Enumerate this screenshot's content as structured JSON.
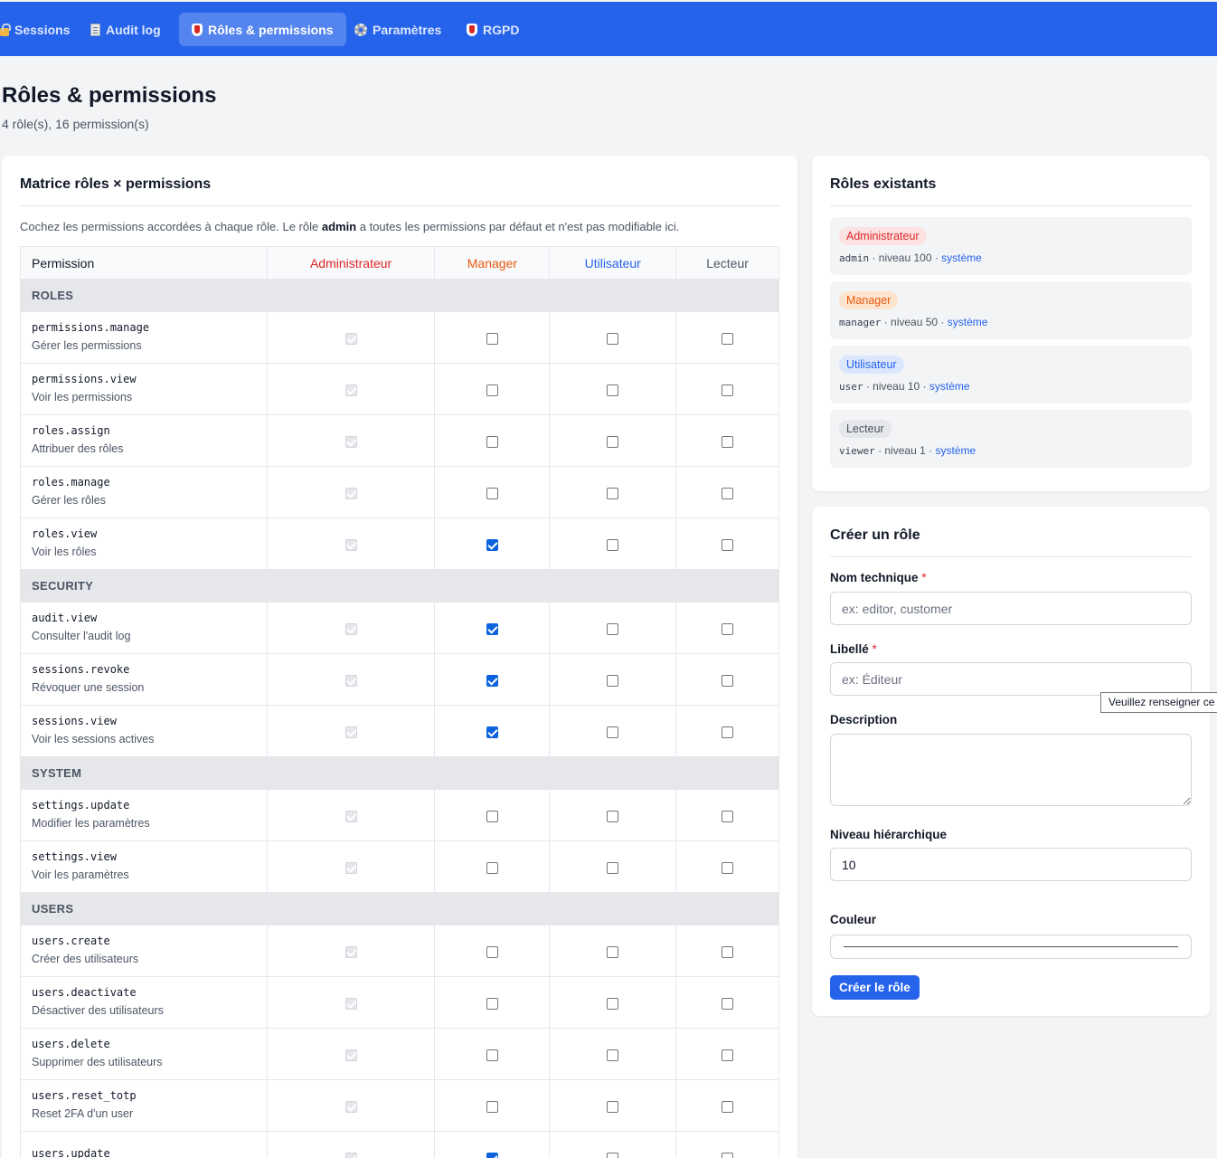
{
  "nav": {
    "items": [
      {
        "label": "Sessions",
        "icon": "lock-icon"
      },
      {
        "label": "Audit log",
        "icon": "document-icon"
      },
      {
        "label": "Rôles & permissions",
        "icon": "shield-icon",
        "active": true
      },
      {
        "label": "Paramètres",
        "icon": "gear-icon"
      },
      {
        "label": "RGPD",
        "icon": "shield-icon"
      }
    ]
  },
  "header": {
    "title": "Rôles & permissions",
    "subtitle": "4 rôle(s), 16 permission(s)"
  },
  "matrix": {
    "title": "Matrice rôles × permissions",
    "intro_before": "Cochez les permissions accordées à chaque rôle. Le rôle ",
    "intro_bold": "admin",
    "intro_after": " a toutes les permissions par défaut et n'est pas modifiable ici.",
    "columns": {
      "permission": "Permission",
      "admin": "Administrateur",
      "manager": "Manager",
      "user": "Utilisateur",
      "viewer": "Lecteur"
    },
    "groups": [
      {
        "name": "ROLES",
        "permissions": [
          {
            "code": "permissions.manage",
            "label": "Gérer les permissions",
            "manager": false,
            "user": false,
            "viewer": false
          },
          {
            "code": "permissions.view",
            "label": "Voir les permissions",
            "manager": false,
            "user": false,
            "viewer": false
          },
          {
            "code": "roles.assign",
            "label": "Attribuer des rôles",
            "manager": false,
            "user": false,
            "viewer": false
          },
          {
            "code": "roles.manage",
            "label": "Gérer les rôles",
            "manager": false,
            "user": false,
            "viewer": false
          },
          {
            "code": "roles.view",
            "label": "Voir les rôles",
            "manager": true,
            "user": false,
            "viewer": false
          }
        ]
      },
      {
        "name": "SECURITY",
        "permissions": [
          {
            "code": "audit.view",
            "label": "Consulter l'audit log",
            "manager": true,
            "user": false,
            "viewer": false
          },
          {
            "code": "sessions.revoke",
            "label": "Révoquer une session",
            "manager": true,
            "user": false,
            "viewer": false
          },
          {
            "code": "sessions.view",
            "label": "Voir les sessions actives",
            "manager": true,
            "user": false,
            "viewer": false
          }
        ]
      },
      {
        "name": "SYSTEM",
        "permissions": [
          {
            "code": "settings.update",
            "label": "Modifier les paramètres",
            "manager": false,
            "user": false,
            "viewer": false
          },
          {
            "code": "settings.view",
            "label": "Voir les paramètres",
            "manager": false,
            "user": false,
            "viewer": false
          }
        ]
      },
      {
        "name": "USERS",
        "permissions": [
          {
            "code": "users.create",
            "label": "Créer des utilisateurs",
            "manager": false,
            "user": false,
            "viewer": false
          },
          {
            "code": "users.deactivate",
            "label": "Désactiver des utilisateurs",
            "manager": false,
            "user": false,
            "viewer": false
          },
          {
            "code": "users.delete",
            "label": "Supprimer des utilisateurs",
            "manager": false,
            "user": false,
            "viewer": false
          },
          {
            "code": "users.reset_totp",
            "label": "Reset 2FA d'un user",
            "manager": false,
            "user": false,
            "viewer": false
          },
          {
            "code": "users.update",
            "label": "",
            "manager": true,
            "user": false,
            "viewer": false
          }
        ]
      }
    ]
  },
  "roles_card": {
    "title": "Rôles existants",
    "roles": [
      {
        "badge": "Administrateur",
        "code": "admin",
        "level": " · niveau 100 · ",
        "system": "système",
        "color": "#dc2626",
        "bg": "#fde2e2"
      },
      {
        "badge": "Manager",
        "code": "manager",
        "level": " · niveau 50 · ",
        "system": "système",
        "color": "#ea580c",
        "bg": "#fde4cf"
      },
      {
        "badge": "Utilisateur",
        "code": "user",
        "level": " · niveau 10 · ",
        "system": "système",
        "color": "#2563eb",
        "bg": "#dbe7fd"
      },
      {
        "badge": "Lecteur",
        "code": "viewer",
        "level": " · niveau 1 · ",
        "system": "système",
        "color": "#4b5563",
        "bg": "#e5e7eb"
      }
    ]
  },
  "create_form": {
    "title": "Créer un rôle",
    "name_label": "Nom technique",
    "name_placeholder": "ex: editor, customer",
    "libelle_label": "Libellé",
    "libelle_placeholder": "ex: Éditeur",
    "required_mark": "*",
    "description_label": "Description",
    "level_label": "Niveau hiérarchique",
    "level_value": "10",
    "color_label": "Couleur",
    "submit_label": "Créer le rôle",
    "tooltip": "Veuillez renseigner ce champ."
  },
  "colors": {
    "accent": "#2563eb",
    "nav_bg": "#2563eb",
    "page_bg": "#f3f4f6"
  }
}
